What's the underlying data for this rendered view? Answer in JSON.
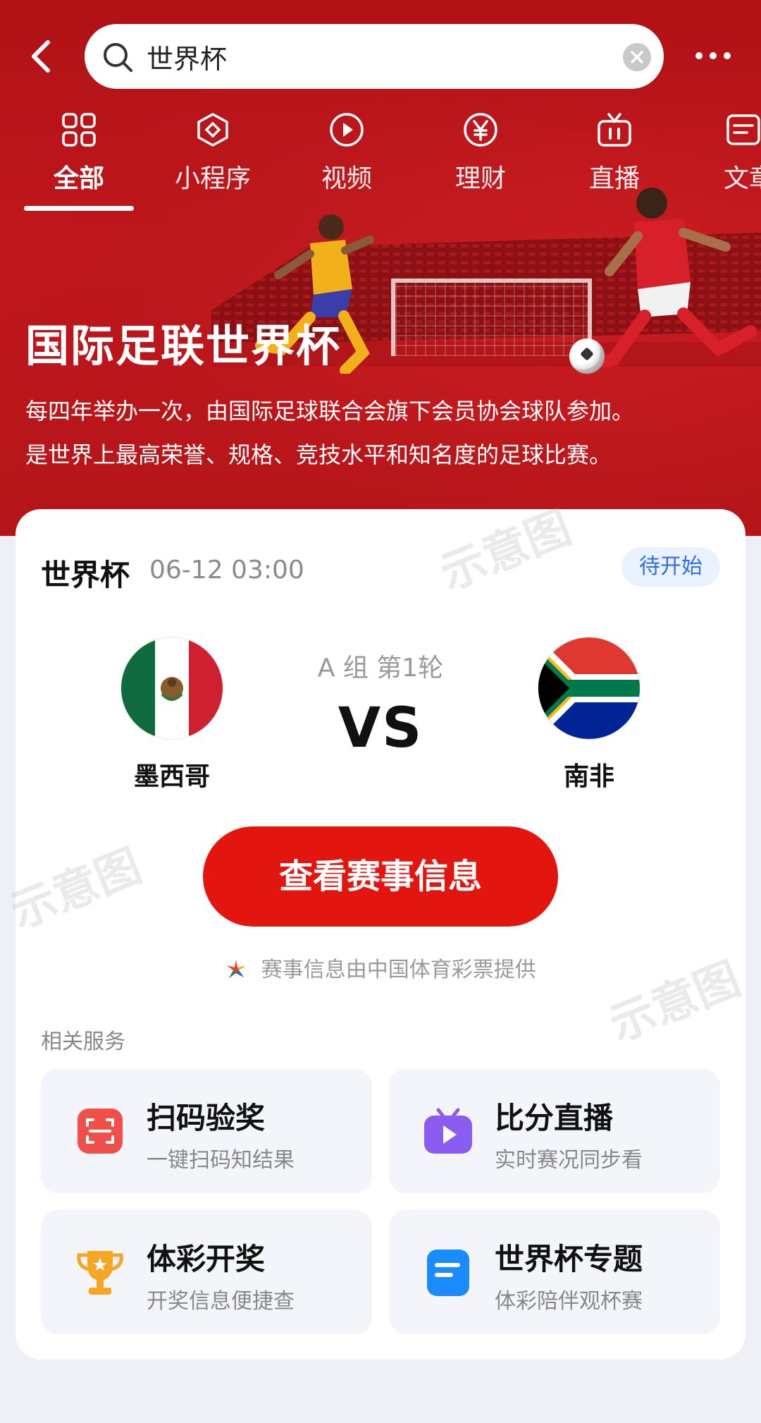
{
  "search": {
    "value": "世界杯"
  },
  "tabs": [
    {
      "label": "全部",
      "icon": "grid-icon",
      "active": true
    },
    {
      "label": "小程序",
      "icon": "mini-program-icon"
    },
    {
      "label": "视频",
      "icon": "video-icon"
    },
    {
      "label": "理财",
      "icon": "yuan-icon"
    },
    {
      "label": "直播",
      "icon": "live-tv-icon"
    },
    {
      "label": "文章",
      "icon": "article-icon"
    }
  ],
  "hero": {
    "title": "国际足联世界杯",
    "description_line1": "每四年举办一次，由国际足球联合会旗下会员协会球队参加。",
    "description_line2": "是世界上最高荣誉、规格、竞技水平和知名度的足球比赛。"
  },
  "match": {
    "title": "世界杯",
    "time": "06-12 03:00",
    "status": "待开始",
    "group_round": "A 组 第1轮",
    "vs": "VS",
    "home": {
      "name": "墨西哥",
      "flag": "mexico-flag"
    },
    "away": {
      "name": "南非",
      "flag": "south-africa-flag"
    }
  },
  "cta_label": "查看赛事信息",
  "provider_text": "赛事信息由中国体育彩票提供",
  "services": {
    "label": "相关服务",
    "items": [
      {
        "title": "扫码验奖",
        "subtitle": "一键扫码知结果",
        "icon": "scan-icon",
        "color": "#f0504a"
      },
      {
        "title": "比分直播",
        "subtitle": "实时赛况同步看",
        "icon": "tv-play-icon",
        "color": "#8a5cf0"
      },
      {
        "title": "体彩开奖",
        "subtitle": "开奖信息便捷查",
        "icon": "trophy-icon",
        "color": "#f5a623"
      },
      {
        "title": "世界杯专题",
        "subtitle": "体彩陪伴观杯赛",
        "icon": "topic-doc-icon",
        "color": "#1a8cff"
      }
    ]
  },
  "watermark": "示意图",
  "colors": {
    "brand_red": "#c0171c",
    "cta_red": "#e3150f",
    "status_blue": "#2b6fe8"
  }
}
